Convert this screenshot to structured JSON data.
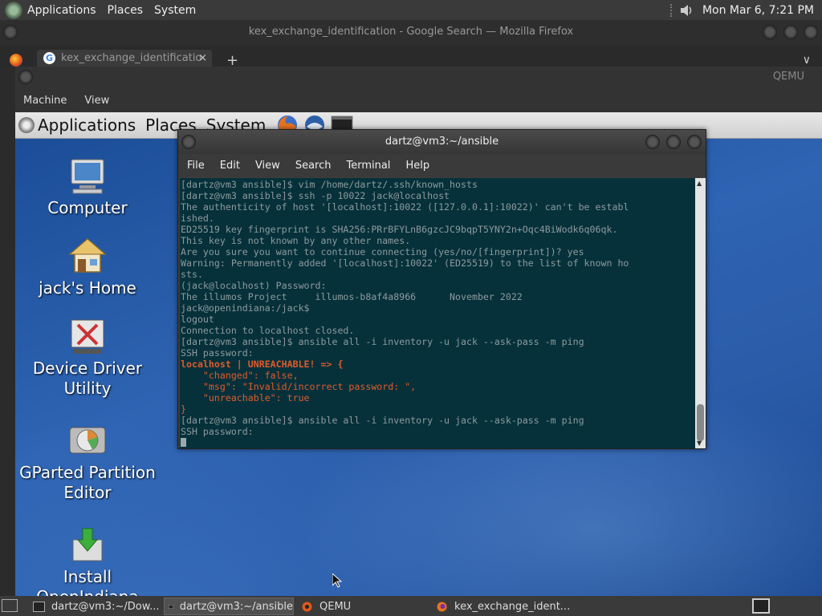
{
  "host_panel": {
    "menus": [
      "Applications",
      "Places",
      "System"
    ],
    "clock": "Mon Mar  6,  7:21 PM"
  },
  "firefox": {
    "window_title": "kex_exchange_identification - Google Search — Mozilla Firefox",
    "tab_title": "kex_exchange_identificatio",
    "tab_close": "×",
    "new_tab": "+",
    "tab_list": "∨"
  },
  "qemu": {
    "title": "QEMU",
    "menus": [
      "Machine",
      "View"
    ]
  },
  "guest": {
    "panel_menus": [
      "Applications",
      "Places",
      "System"
    ],
    "desktop_icons": [
      {
        "label": "Computer"
      },
      {
        "label": "jack's Home"
      },
      {
        "label": "Device Driver Utility"
      },
      {
        "label": "GParted Partition Editor"
      },
      {
        "label": "Install OpenIndiana"
      }
    ]
  },
  "terminal": {
    "title": "dartz@vm3:~/ansible",
    "menus": [
      "File",
      "Edit",
      "View",
      "Search",
      "Terminal",
      "Help"
    ],
    "lines": [
      "[dartz@vm3 ansible]$ vim /home/dartz/.ssh/known_hosts",
      "[dartz@vm3 ansible]$ ssh -p 10022 jack@localhost",
      "The authenticity of host '[localhost]:10022 ([127.0.0.1]:10022)' can't be establ",
      "ished.",
      "ED25519 key fingerprint is SHA256:PRrBFYLnB6gzcJC9bqpT5YNY2n+Oqc4BiWodk6q06qk.",
      "This key is not known by any other names.",
      "Are you sure you want to continue connecting (yes/no/[fingerprint])? yes",
      "Warning: Permanently added '[localhost]:10022' (ED25519) to the list of known ho",
      "sts.",
      "(jack@localhost) Password:",
      "The illumos Project     illumos-b8af4a8966      November 2022",
      "jack@openindiana:/jack$",
      "logout",
      "Connection to localhost closed.",
      "[dartz@vm3 ansible]$ ansible all -i inventory -u jack --ask-pass -m ping",
      "SSH password:",
      "localhost | UNREACHABLE! => {",
      "    \"changed\": false,",
      "    \"msg\": \"Invalid/incorrect password: \",",
      "    \"unreachable\": true",
      "}",
      "[dartz@vm3 ansible]$ ansible all -i inventory -u jack --ask-pass -m ping",
      "SSH password:"
    ]
  },
  "taskbar": {
    "items": [
      {
        "label": "dartz@vm3:~/Dow..."
      },
      {
        "label": "dartz@vm3:~/ansible"
      },
      {
        "label": "QEMU"
      },
      {
        "label": "kex_exchange_ident..."
      }
    ]
  },
  "colors": {
    "terminal_bg": "#06313b",
    "terminal_text": "#8e9a9c",
    "error_text": "#e25a2a",
    "desktop_blue": "#2e64b3"
  }
}
